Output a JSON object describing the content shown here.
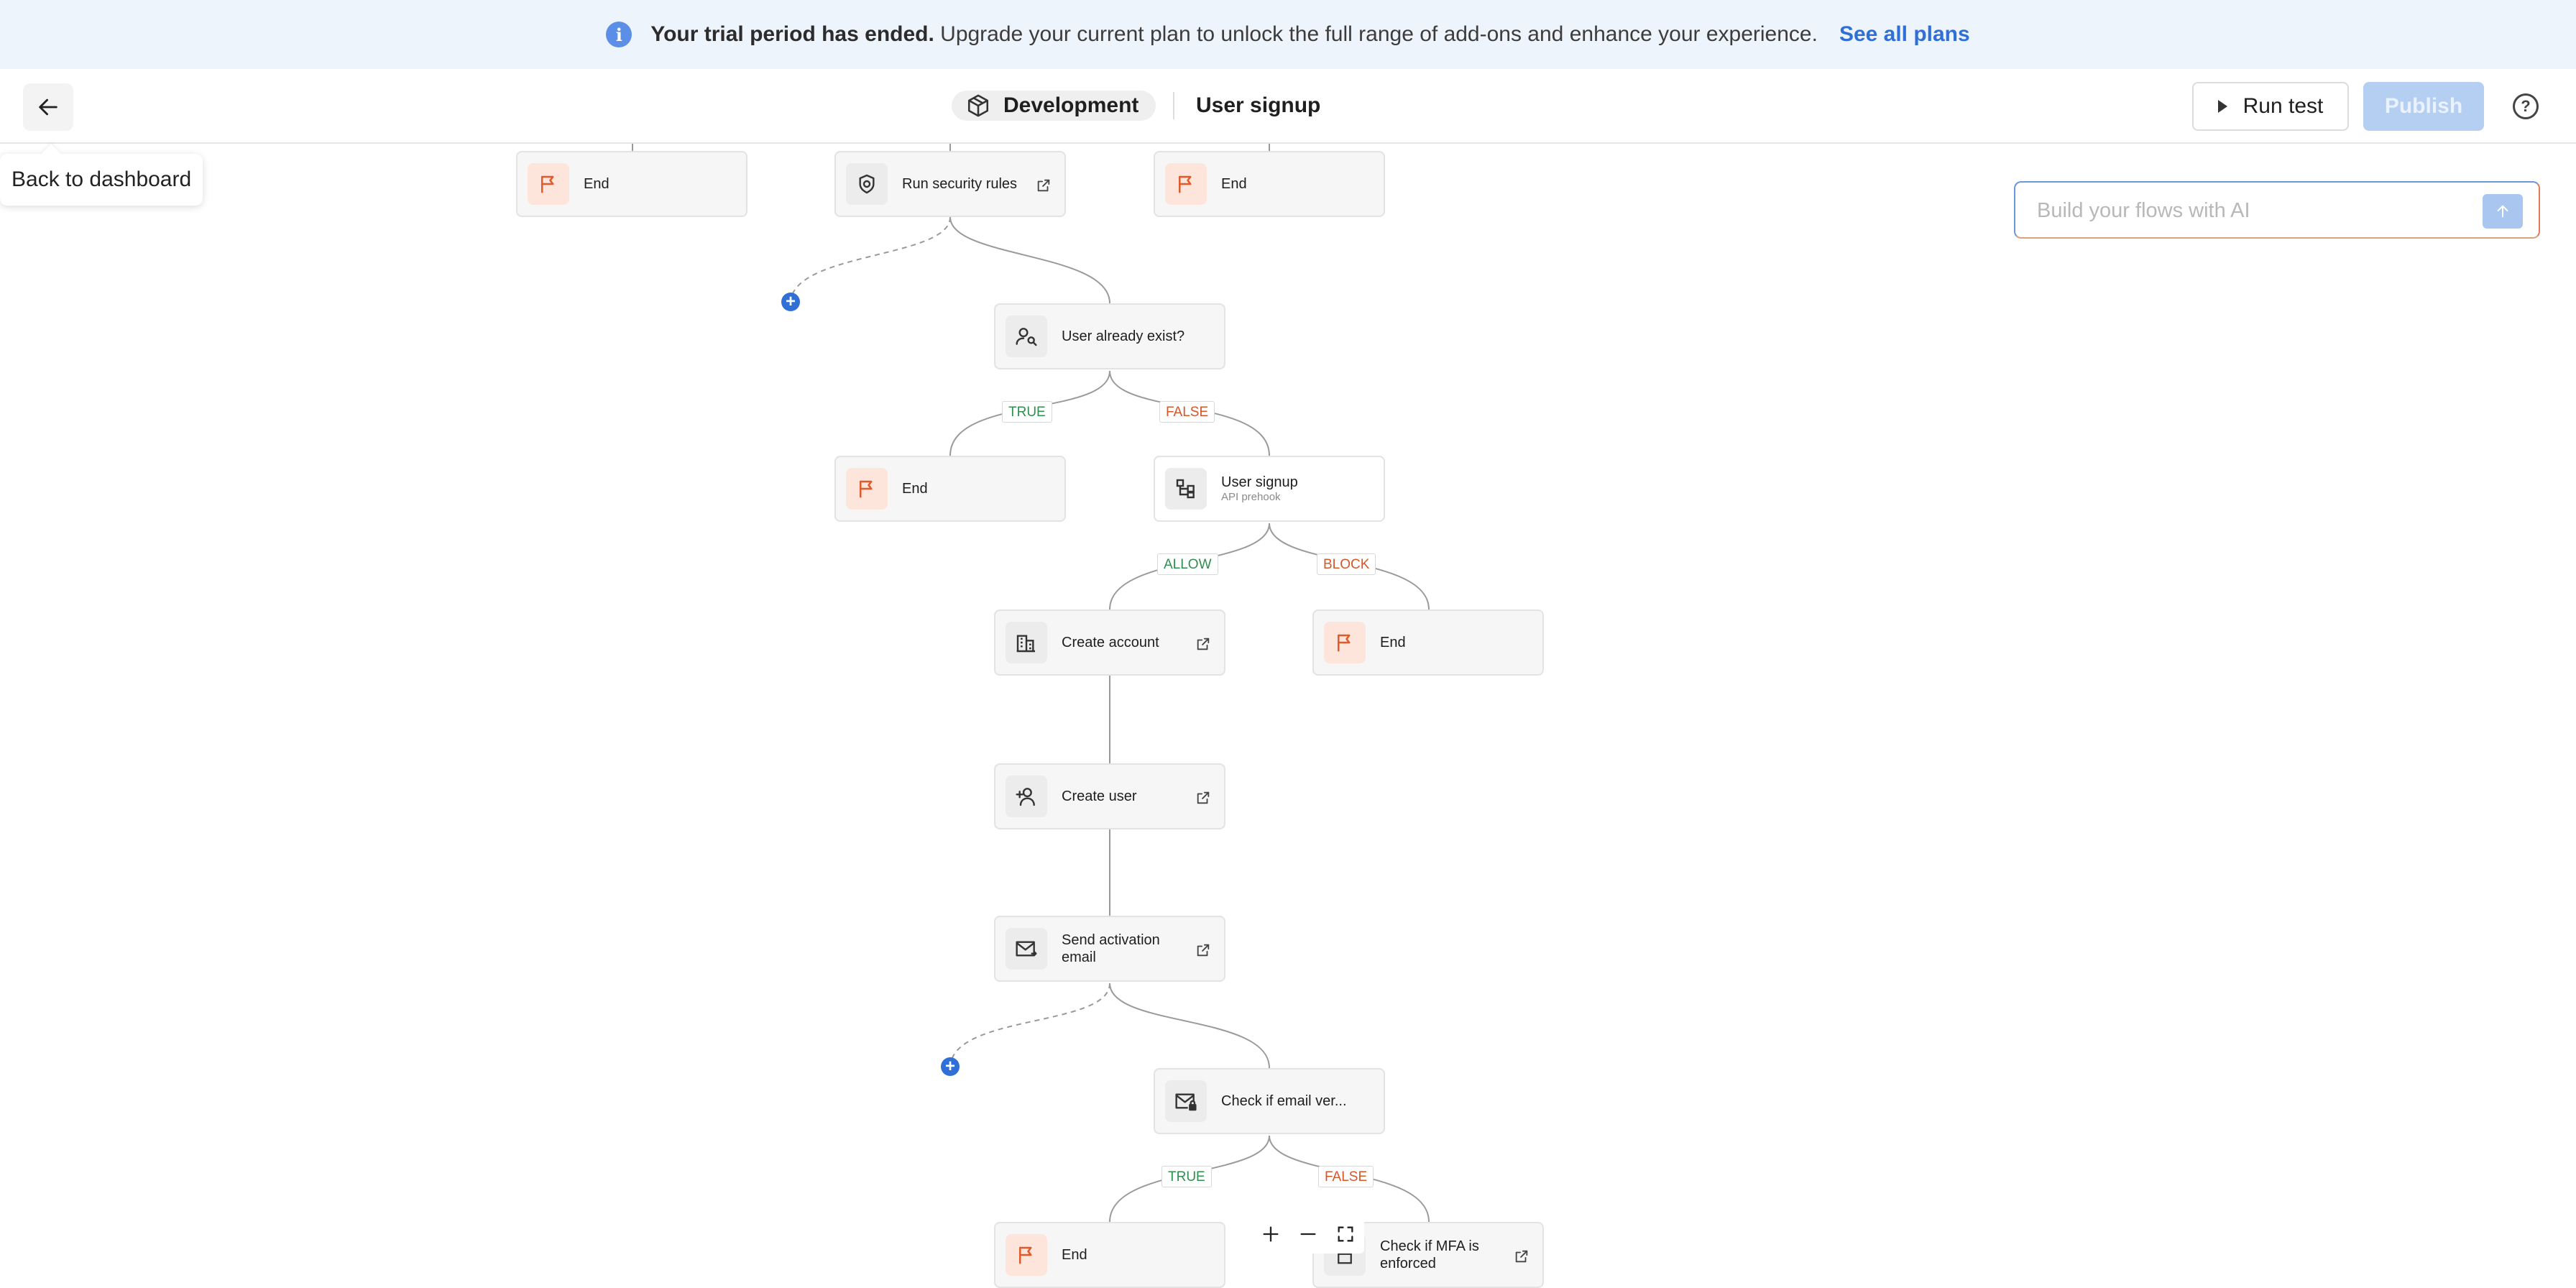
{
  "banner": {
    "icon": "info-icon",
    "bold_text": "Your trial period has ended.",
    "text": " Upgrade your current plan to unlock the full range of add-ons and enhance your experience.",
    "link": "See all plans"
  },
  "header": {
    "back_icon": "arrow-left-icon",
    "back_tooltip": "Back to dashboard",
    "environment": "Development",
    "flow_name": "User signup",
    "run_test_label": "Run test",
    "publish_label": "Publish",
    "help_icon": "help-circle-icon"
  },
  "ai_input": {
    "placeholder": "Build your flows with AI",
    "value": ""
  },
  "nodes": {
    "end_1": {
      "label": "End",
      "icon": "flag-icon"
    },
    "security": {
      "label": "Run security rules",
      "icon": "shield-icon"
    },
    "end_2": {
      "label": "End",
      "icon": "flag-icon"
    },
    "user_exist": {
      "label": "User already exist?",
      "icon": "user-search-icon"
    },
    "end_3": {
      "label": "End",
      "icon": "flag-icon"
    },
    "user_signup": {
      "label": "User signup",
      "sublabel": "API prehook",
      "icon": "hierarchy-icon"
    },
    "create_account": {
      "label": "Create account",
      "icon": "building-icon"
    },
    "end_4": {
      "label": "End",
      "icon": "flag-icon"
    },
    "create_user": {
      "label": "Create user",
      "icon": "user-add-icon"
    },
    "send_email": {
      "label": "Send activation email",
      "icon": "mail-send-icon"
    },
    "check_email": {
      "label": "Check if email ver...",
      "icon": "mail-lock-icon"
    },
    "end_5": {
      "label": "End",
      "icon": "flag-icon"
    },
    "check_mfa": {
      "label": "Check if MFA is enforced",
      "icon": "lock-icon"
    }
  },
  "edge_labels": {
    "exist_true": "TRUE",
    "exist_false": "FALSE",
    "signup_allow": "ALLOW",
    "signup_block": "BLOCK",
    "email_true": "TRUE",
    "email_false": "FALSE"
  },
  "zoom": {
    "zoom_in": "+",
    "zoom_out": "—"
  },
  "colors": {
    "accent": "#2f6fd6",
    "true": "#2f8f4e",
    "false": "#d4572a",
    "end_icon": "#e05a2b"
  }
}
